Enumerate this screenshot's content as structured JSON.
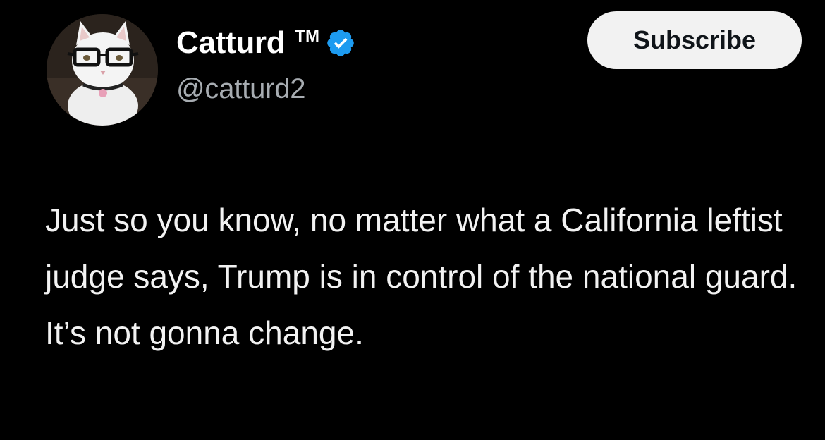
{
  "author": {
    "display_name": "Catturd",
    "tm_mark": "TM",
    "handle": "@catturd2",
    "verified": true,
    "verified_icon": "verified-badge-icon",
    "avatar": "cat-with-glasses-avatar"
  },
  "actions": {
    "subscribe_label": "Subscribe"
  },
  "tweet": {
    "text": "Just so you know, no matter what a California leftist judge says, Trump is in control of the national guard. It’s not gonna change."
  },
  "colors": {
    "background": "#000000",
    "text": "#e7e9ea",
    "handle": "#a7acb1",
    "verified_blue": "#1d9bf0",
    "button_bg": "#f2f2f2"
  }
}
